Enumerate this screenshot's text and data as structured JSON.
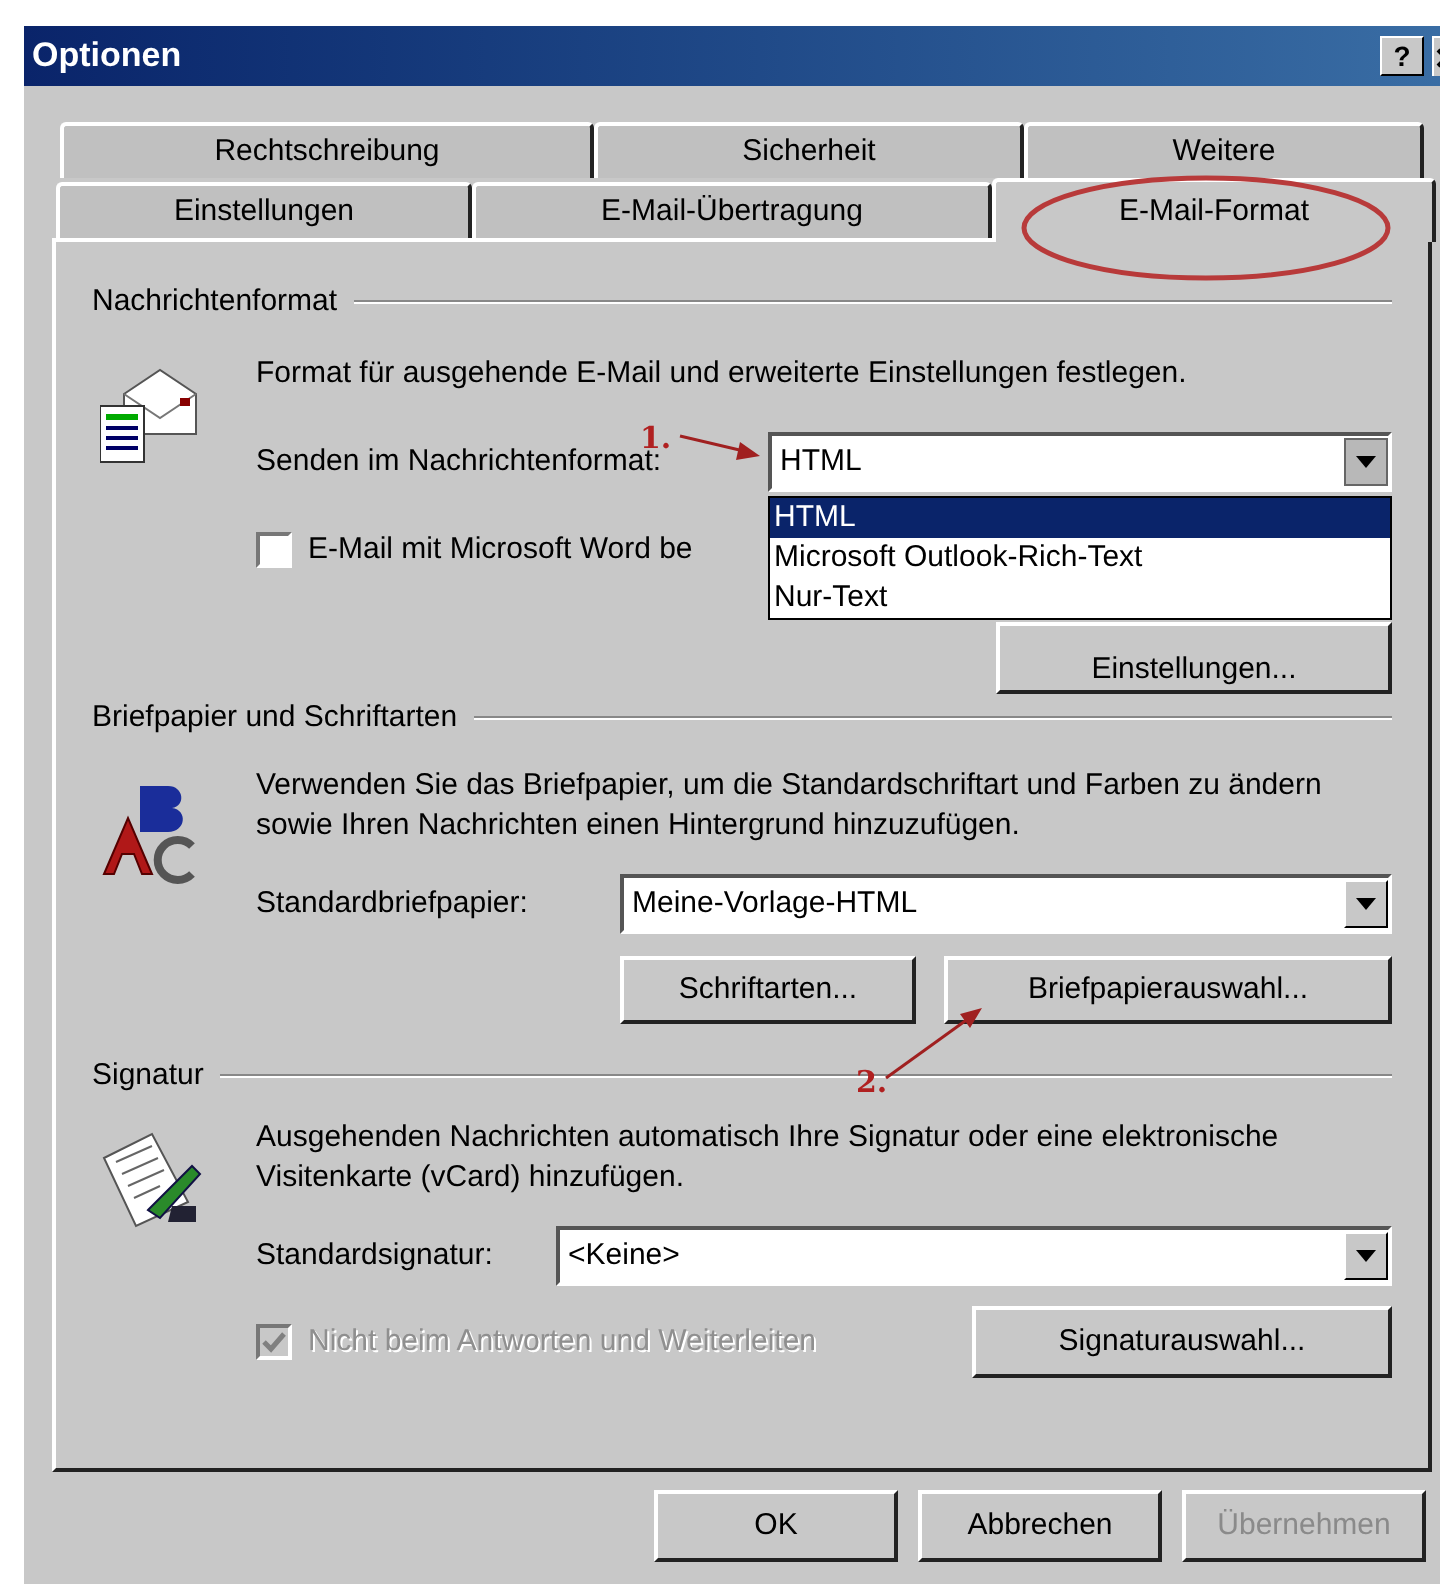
{
  "window": {
    "title": "Optionen",
    "help": "?"
  },
  "tab_rows": [
    [
      {
        "label": "Rechtschreibung",
        "selected": false
      },
      {
        "label": "Sicherheit",
        "selected": false
      },
      {
        "label": "Weitere",
        "selected": false
      }
    ],
    [
      {
        "label": "Einstellungen",
        "selected": false
      },
      {
        "label": "E-Mail-Übertragung",
        "selected": false
      },
      {
        "label": "E-Mail-Format",
        "selected": true
      }
    ]
  ],
  "sections": [
    {
      "kind": "format",
      "title": "Nachrichtenformat",
      "description": "Format für ausgehende E-Mail und erweiterte Einstellungen festlegen.",
      "combo": {
        "label": "Senden im Nachrichtenformat:",
        "value": "HTML",
        "expanded": true,
        "options": [
          {
            "label": "HTML",
            "selected": true
          },
          {
            "label": "Microsoft Outlook-Rich-Text",
            "selected": false
          },
          {
            "label": "Nur-Text",
            "selected": false
          }
        ]
      },
      "checkbox": {
        "label": "E-Mail mit Microsoft Word be",
        "checked": false,
        "disabled": false
      },
      "button": {
        "label": "Einstellungen..."
      }
    },
    {
      "kind": "stationery",
      "title": "Briefpapier und Schriftarten",
      "description": "Verwenden Sie das Briefpapier, um die Standardschriftart und Farben zu ändern sowie Ihren Nachrichten einen Hintergrund hinzuzufügen.",
      "combo": {
        "label": "Standardbriefpapier:",
        "value": "Meine-Vorlage-HTML"
      },
      "buttons": [
        {
          "label": "Schriftarten..."
        },
        {
          "label": "Briefpapierauswahl..."
        }
      ]
    },
    {
      "kind": "signature",
      "title": "Signatur",
      "description": "Ausgehenden Nachrichten automatisch Ihre Signatur oder eine elektronische Visitenkarte (vCard) hinzufügen.",
      "combo": {
        "label": "Standardsignatur:",
        "value": "<Keine>"
      },
      "checkbox": {
        "label": "Nicht beim Antworten und Weiterleiten",
        "checked": true,
        "disabled": true
      },
      "button": {
        "label": "Signaturauswahl..."
      }
    }
  ],
  "buttons": [
    {
      "label": "OK",
      "disabled": false
    },
    {
      "label": "Abbrechen",
      "disabled": false
    },
    {
      "label": "Übernehmen",
      "disabled": true
    }
  ],
  "annotations": [
    {
      "text": "1."
    },
    {
      "text": "2."
    }
  ]
}
